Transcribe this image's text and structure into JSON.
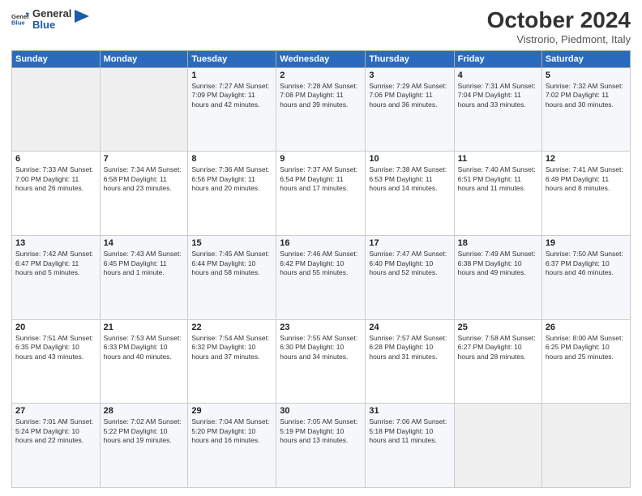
{
  "logo": {
    "general": "General",
    "blue": "Blue"
  },
  "header": {
    "title": "October 2024",
    "subtitle": "Vistrorio, Piedmont, Italy"
  },
  "columns": [
    "Sunday",
    "Monday",
    "Tuesday",
    "Wednesday",
    "Thursday",
    "Friday",
    "Saturday"
  ],
  "weeks": [
    [
      {
        "day": "",
        "info": ""
      },
      {
        "day": "",
        "info": ""
      },
      {
        "day": "1",
        "info": "Sunrise: 7:27 AM\nSunset: 7:09 PM\nDaylight: 11 hours\nand 42 minutes."
      },
      {
        "day": "2",
        "info": "Sunrise: 7:28 AM\nSunset: 7:08 PM\nDaylight: 11 hours\nand 39 minutes."
      },
      {
        "day": "3",
        "info": "Sunrise: 7:29 AM\nSunset: 7:06 PM\nDaylight: 11 hours\nand 36 minutes."
      },
      {
        "day": "4",
        "info": "Sunrise: 7:31 AM\nSunset: 7:04 PM\nDaylight: 11 hours\nand 33 minutes."
      },
      {
        "day": "5",
        "info": "Sunrise: 7:32 AM\nSunset: 7:02 PM\nDaylight: 11 hours\nand 30 minutes."
      }
    ],
    [
      {
        "day": "6",
        "info": "Sunrise: 7:33 AM\nSunset: 7:00 PM\nDaylight: 11 hours\nand 26 minutes."
      },
      {
        "day": "7",
        "info": "Sunrise: 7:34 AM\nSunset: 6:58 PM\nDaylight: 11 hours\nand 23 minutes."
      },
      {
        "day": "8",
        "info": "Sunrise: 7:36 AM\nSunset: 6:56 PM\nDaylight: 11 hours\nand 20 minutes."
      },
      {
        "day": "9",
        "info": "Sunrise: 7:37 AM\nSunset: 6:54 PM\nDaylight: 11 hours\nand 17 minutes."
      },
      {
        "day": "10",
        "info": "Sunrise: 7:38 AM\nSunset: 6:53 PM\nDaylight: 11 hours\nand 14 minutes."
      },
      {
        "day": "11",
        "info": "Sunrise: 7:40 AM\nSunset: 6:51 PM\nDaylight: 11 hours\nand 11 minutes."
      },
      {
        "day": "12",
        "info": "Sunrise: 7:41 AM\nSunset: 6:49 PM\nDaylight: 11 hours\nand 8 minutes."
      }
    ],
    [
      {
        "day": "13",
        "info": "Sunrise: 7:42 AM\nSunset: 6:47 PM\nDaylight: 11 hours\nand 5 minutes."
      },
      {
        "day": "14",
        "info": "Sunrise: 7:43 AM\nSunset: 6:45 PM\nDaylight: 11 hours\nand 1 minute."
      },
      {
        "day": "15",
        "info": "Sunrise: 7:45 AM\nSunset: 6:44 PM\nDaylight: 10 hours\nand 58 minutes."
      },
      {
        "day": "16",
        "info": "Sunrise: 7:46 AM\nSunset: 6:42 PM\nDaylight: 10 hours\nand 55 minutes."
      },
      {
        "day": "17",
        "info": "Sunrise: 7:47 AM\nSunset: 6:40 PM\nDaylight: 10 hours\nand 52 minutes."
      },
      {
        "day": "18",
        "info": "Sunrise: 7:49 AM\nSunset: 6:38 PM\nDaylight: 10 hours\nand 49 minutes."
      },
      {
        "day": "19",
        "info": "Sunrise: 7:50 AM\nSunset: 6:37 PM\nDaylight: 10 hours\nand 46 minutes."
      }
    ],
    [
      {
        "day": "20",
        "info": "Sunrise: 7:51 AM\nSunset: 6:35 PM\nDaylight: 10 hours\nand 43 minutes."
      },
      {
        "day": "21",
        "info": "Sunrise: 7:53 AM\nSunset: 6:33 PM\nDaylight: 10 hours\nand 40 minutes."
      },
      {
        "day": "22",
        "info": "Sunrise: 7:54 AM\nSunset: 6:32 PM\nDaylight: 10 hours\nand 37 minutes."
      },
      {
        "day": "23",
        "info": "Sunrise: 7:55 AM\nSunset: 6:30 PM\nDaylight: 10 hours\nand 34 minutes."
      },
      {
        "day": "24",
        "info": "Sunrise: 7:57 AM\nSunset: 6:28 PM\nDaylight: 10 hours\nand 31 minutes."
      },
      {
        "day": "25",
        "info": "Sunrise: 7:58 AM\nSunset: 6:27 PM\nDaylight: 10 hours\nand 28 minutes."
      },
      {
        "day": "26",
        "info": "Sunrise: 8:00 AM\nSunset: 6:25 PM\nDaylight: 10 hours\nand 25 minutes."
      }
    ],
    [
      {
        "day": "27",
        "info": "Sunrise: 7:01 AM\nSunset: 5:24 PM\nDaylight: 10 hours\nand 22 minutes."
      },
      {
        "day": "28",
        "info": "Sunrise: 7:02 AM\nSunset: 5:22 PM\nDaylight: 10 hours\nand 19 minutes."
      },
      {
        "day": "29",
        "info": "Sunrise: 7:04 AM\nSunset: 5:20 PM\nDaylight: 10 hours\nand 16 minutes."
      },
      {
        "day": "30",
        "info": "Sunrise: 7:05 AM\nSunset: 5:19 PM\nDaylight: 10 hours\nand 13 minutes."
      },
      {
        "day": "31",
        "info": "Sunrise: 7:06 AM\nSunset: 5:18 PM\nDaylight: 10 hours\nand 11 minutes."
      },
      {
        "day": "",
        "info": ""
      },
      {
        "day": "",
        "info": ""
      }
    ]
  ]
}
